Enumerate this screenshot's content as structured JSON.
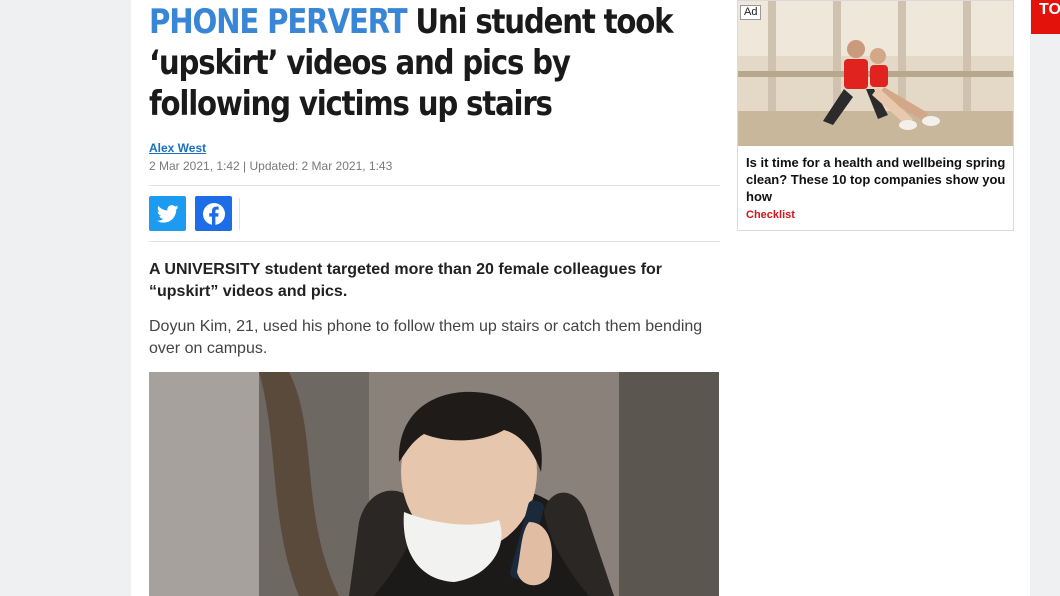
{
  "article": {
    "kicker": "PHONE PERVERT",
    "headline_rest": " Uni student took ‘upskirt’ videos and pics by following victims up stairs",
    "author": "Alex West",
    "dates": "2 Mar 2021, 1:42 | Updated: 2 Mar 2021, 1:43",
    "lede": "A UNIVERSITY student targeted more than 20 female colleagues for “upskirt” videos and pics.",
    "paragraph": "Doyun Kim, 21, used his phone to follow them up stairs or catch them bending over on campus."
  },
  "share": {
    "twitter_icon": "twitter-icon",
    "facebook_icon": "facebook-icon"
  },
  "ad": {
    "badge": "Ad",
    "title": "Is it time for a health and wellbeing spring clean? These 10 top companies show you how",
    "source": "Checklist"
  },
  "top_tab": {
    "label": "TO"
  },
  "colors": {
    "kicker": "#3a86d6",
    "twitter": "#1d9bf0",
    "facebook": "#1d6ee6",
    "ad_source": "#d2141b",
    "top_tab": "#e3120b"
  }
}
